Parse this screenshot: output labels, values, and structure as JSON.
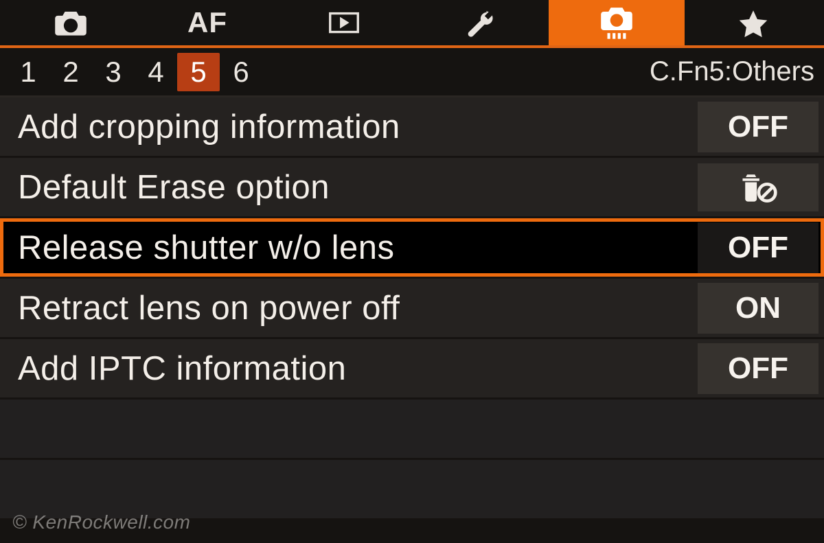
{
  "tabs": [
    {
      "name": "shooting",
      "icon": "camera",
      "active": false
    },
    {
      "name": "af",
      "icon": "af-text",
      "active": false,
      "text": "AF"
    },
    {
      "name": "playback",
      "icon": "play",
      "active": false
    },
    {
      "name": "setup",
      "icon": "wrench",
      "active": false
    },
    {
      "name": "custom-fn",
      "icon": "camera-dots",
      "active": true
    },
    {
      "name": "mymenu",
      "icon": "star",
      "active": false
    }
  ],
  "pages": {
    "numbers": [
      "1",
      "2",
      "3",
      "4",
      "5",
      "6"
    ],
    "active_index": 4,
    "title": "C.Fn5:Others"
  },
  "menu": [
    {
      "label": "Add cropping information",
      "value": "OFF",
      "value_type": "text",
      "selected": false
    },
    {
      "label": "Default Erase option",
      "value": "trash-cancel",
      "value_type": "icon",
      "selected": false
    },
    {
      "label": "Release shutter w/o lens",
      "value": "OFF",
      "value_type": "text",
      "selected": true
    },
    {
      "label": "Retract lens on power off",
      "value": "ON",
      "value_type": "text",
      "selected": false
    },
    {
      "label": "Add IPTC information",
      "value": "OFF",
      "value_type": "text",
      "selected": false
    }
  ],
  "empty_rows": 2,
  "watermark": "© KenRockwell.com"
}
